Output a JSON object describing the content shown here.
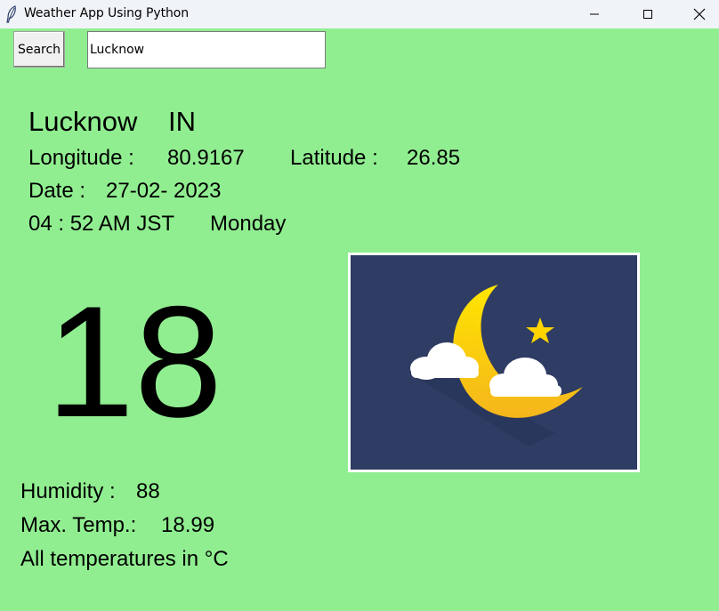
{
  "window": {
    "title": "Weather App Using Python",
    "icon": "feather-icon"
  },
  "search": {
    "button_label": "Search",
    "value": "Lucknow",
    "placeholder": ""
  },
  "location": {
    "city": "Lucknow",
    "country": "IN",
    "longitude_label": "Longitude :",
    "longitude": "80.9167",
    "latitude_label": "Latitude :",
    "latitude": "26.85",
    "date_label": "Date :",
    "date": "27-02- 2023",
    "time": "04 : 52 AM JST",
    "day": "Monday"
  },
  "weather": {
    "temperature": "18",
    "icon": "moon-cloud-night-icon",
    "humidity_label": "Humidity :",
    "humidity": "88",
    "max_temp_label": "Max. Temp.:",
    "max_temp": "18.99",
    "unit_note": "All temperatures in °C"
  },
  "colors": {
    "background": "#90ee90",
    "image_background": "#2f3c63",
    "moon": "#ffd700",
    "cloud": "#ffffff"
  }
}
